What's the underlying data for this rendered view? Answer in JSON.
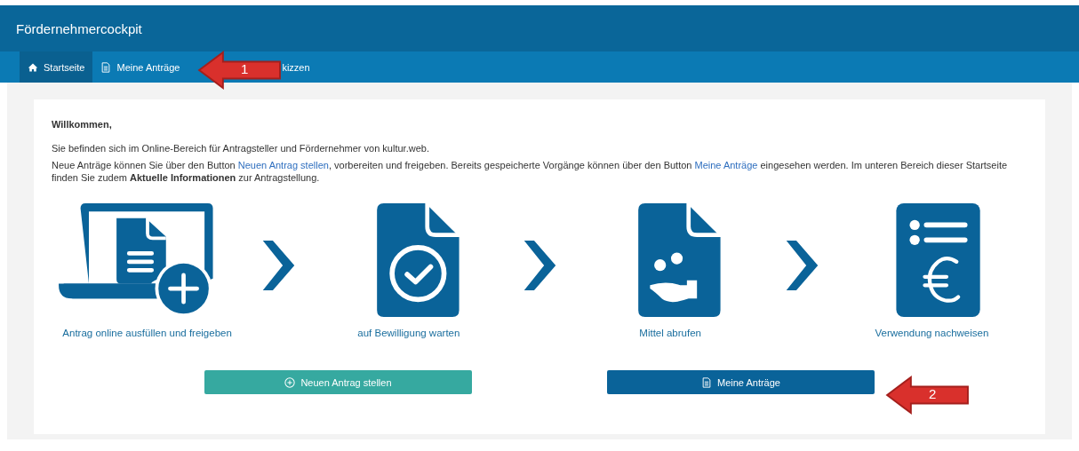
{
  "header": {
    "title": "Fördernehmercockpit"
  },
  "nav": [
    {
      "label": "Startseite",
      "kind": "home",
      "selected": true
    },
    {
      "label": "Meine Anträge",
      "kind": "document",
      "selected": false
    },
    {
      "label": "kizzen",
      "kind": "covered",
      "selected": false
    }
  ],
  "welcome": {
    "heading": "Willkommen,",
    "line": "Sie befinden sich im Online-Bereich für Antragsteller und Fördernehmer von kultur.web.",
    "intro": [
      {
        "kind": "text",
        "text": "Neue Anträge können Sie über den Button "
      },
      {
        "kind": "link",
        "text": "Neuen Antrag stellen"
      },
      {
        "kind": "text",
        "text": ", vorbereiten und freigeben. Bereits gespeicherte Vorgänge können über den Button "
      },
      {
        "kind": "link",
        "text": "Meine Anträge"
      },
      {
        "kind": "text",
        "text": " eingesehen werden. Im unteren Bereich dieser Startseite finden Sie zudem **Aktuelle Informationen** zur Antragstellung."
      }
    ]
  },
  "steps": [
    {
      "kind": "laptop-plus",
      "label": "Antrag online ausfüllen und freigeben"
    },
    {
      "kind": "doc-check",
      "label": "auf Bewilligung warten"
    },
    {
      "kind": "doc-hand",
      "label": "Mittel abrufen"
    },
    {
      "kind": "doc-euro",
      "label": "Verwendung nachweisen"
    }
  ],
  "buttons": [
    {
      "kind": "new",
      "label": "Neuen Antrag stellen"
    },
    {
      "kind": "list",
      "label": "Meine Anträge"
    }
  ],
  "callouts": [
    {
      "kind": "nav",
      "label": "1"
    },
    {
      "kind": "button",
      "label": "2"
    }
  ]
}
